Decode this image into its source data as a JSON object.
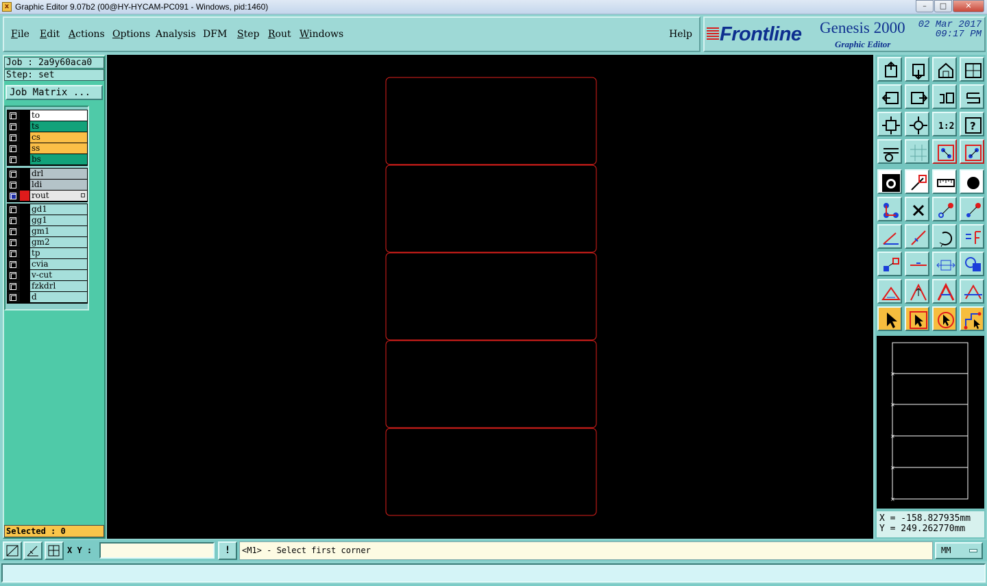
{
  "window": {
    "title": "Graphic Editor 9.07b2 (00@HY-HYCAM-PC091 - Windows, pid:1460)",
    "icon": "x-app-icon",
    "controls": {
      "minimize": "–",
      "maximize": "□",
      "close": "✕"
    }
  },
  "menubar": {
    "items": [
      {
        "label": "File",
        "u": "F"
      },
      {
        "label": "Edit",
        "u": "E"
      },
      {
        "label": "Actions",
        "u": "A"
      },
      {
        "label": "Options",
        "u": "O"
      },
      {
        "label": "Analysis",
        "u": ""
      },
      {
        "label": "DFM",
        "u": ""
      },
      {
        "label": "Step",
        "u": "S"
      },
      {
        "label": "Rout",
        "u": "R"
      },
      {
        "label": "Windows",
        "u": "W"
      }
    ],
    "help": "Help"
  },
  "brand": {
    "logo": "Frontline",
    "product": "Genesis 2000",
    "subtitle": "Graphic Editor",
    "date": "02 Mar 2017",
    "time": "09:17 PM"
  },
  "left_panel": {
    "job": "Job : 2a9y60aca0",
    "step": "Step: set",
    "job_matrix": "Job Matrix ...",
    "layer_groups": [
      [
        {
          "name": "to",
          "color": "#ffffff"
        },
        {
          "name": "ts",
          "color": "#12a27a"
        },
        {
          "name": "cs",
          "color": "#fbbf47"
        },
        {
          "name": "ss",
          "color": "#fbbf47"
        },
        {
          "name": "bs",
          "color": "#12a27a"
        }
      ],
      [
        {
          "name": "drl",
          "color": "#b4c3c8"
        },
        {
          "name": "ldi",
          "color": "#b4c3c8"
        },
        {
          "name": "rout",
          "color": "#e7e7e7",
          "selected": true
        }
      ],
      [
        {
          "name": "gd1",
          "color": "#a6dfdb"
        },
        {
          "name": "gg1",
          "color": "#a6dfdb"
        },
        {
          "name": "gm1",
          "color": "#a6dfdb"
        },
        {
          "name": "gm2",
          "color": "#a6dfdb"
        },
        {
          "name": "tp",
          "color": "#a6dfdb"
        },
        {
          "name": "cvia",
          "color": "#a6dfdb"
        },
        {
          "name": "v-cut",
          "color": "#a6dfdb"
        },
        {
          "name": "fzkdrl",
          "color": "#a6dfdb"
        },
        {
          "name": "d",
          "color": "#a6dfdb"
        }
      ]
    ],
    "selected": "Selected : 0"
  },
  "canvas": {
    "background": "#000000",
    "outline_color": "#e0201c",
    "panel_count": 5
  },
  "toolbox": {
    "tools": [
      "home-up-icon",
      "home-down-icon",
      "home-icon",
      "window-split-icon",
      "pan-left-icon",
      "pan-right-icon",
      "rotate-left-icon",
      "rotate-right-icon",
      "zoom-fit-icon",
      "zoom-center-icon",
      "scale-1-2-icon",
      "help-icon",
      "settings-icon",
      "grid-icon",
      "layers-panel-icon",
      "layers-panel-alt-icon",
      "pad-icon",
      "feature-add-icon",
      "ruler-icon",
      "circle-icon",
      "connect-nodes-icon",
      "cross-icon",
      "segment-icon",
      "segment-alt-icon",
      "angle-icon",
      "line-icon",
      "arc-icon",
      "flip-icon",
      "snap-icon",
      "cut-line-icon",
      "resize-icon",
      "shapes-icon",
      "triangle-icon",
      "triangle-up-icon",
      "letter-a-icon",
      "letter-a-alt-icon",
      "pointer-icon",
      "pointer-select-icon",
      "pointer-rotate-icon",
      "pointer-route-icon"
    ]
  },
  "coords": {
    "x": "X = -158.827935mm",
    "y": "Y = 249.262770mm"
  },
  "statusbar": {
    "xy_label": "X Y :",
    "xy_value": "",
    "warn": "!",
    "prompt": "<M1> - Select first corner",
    "units": "MM"
  }
}
